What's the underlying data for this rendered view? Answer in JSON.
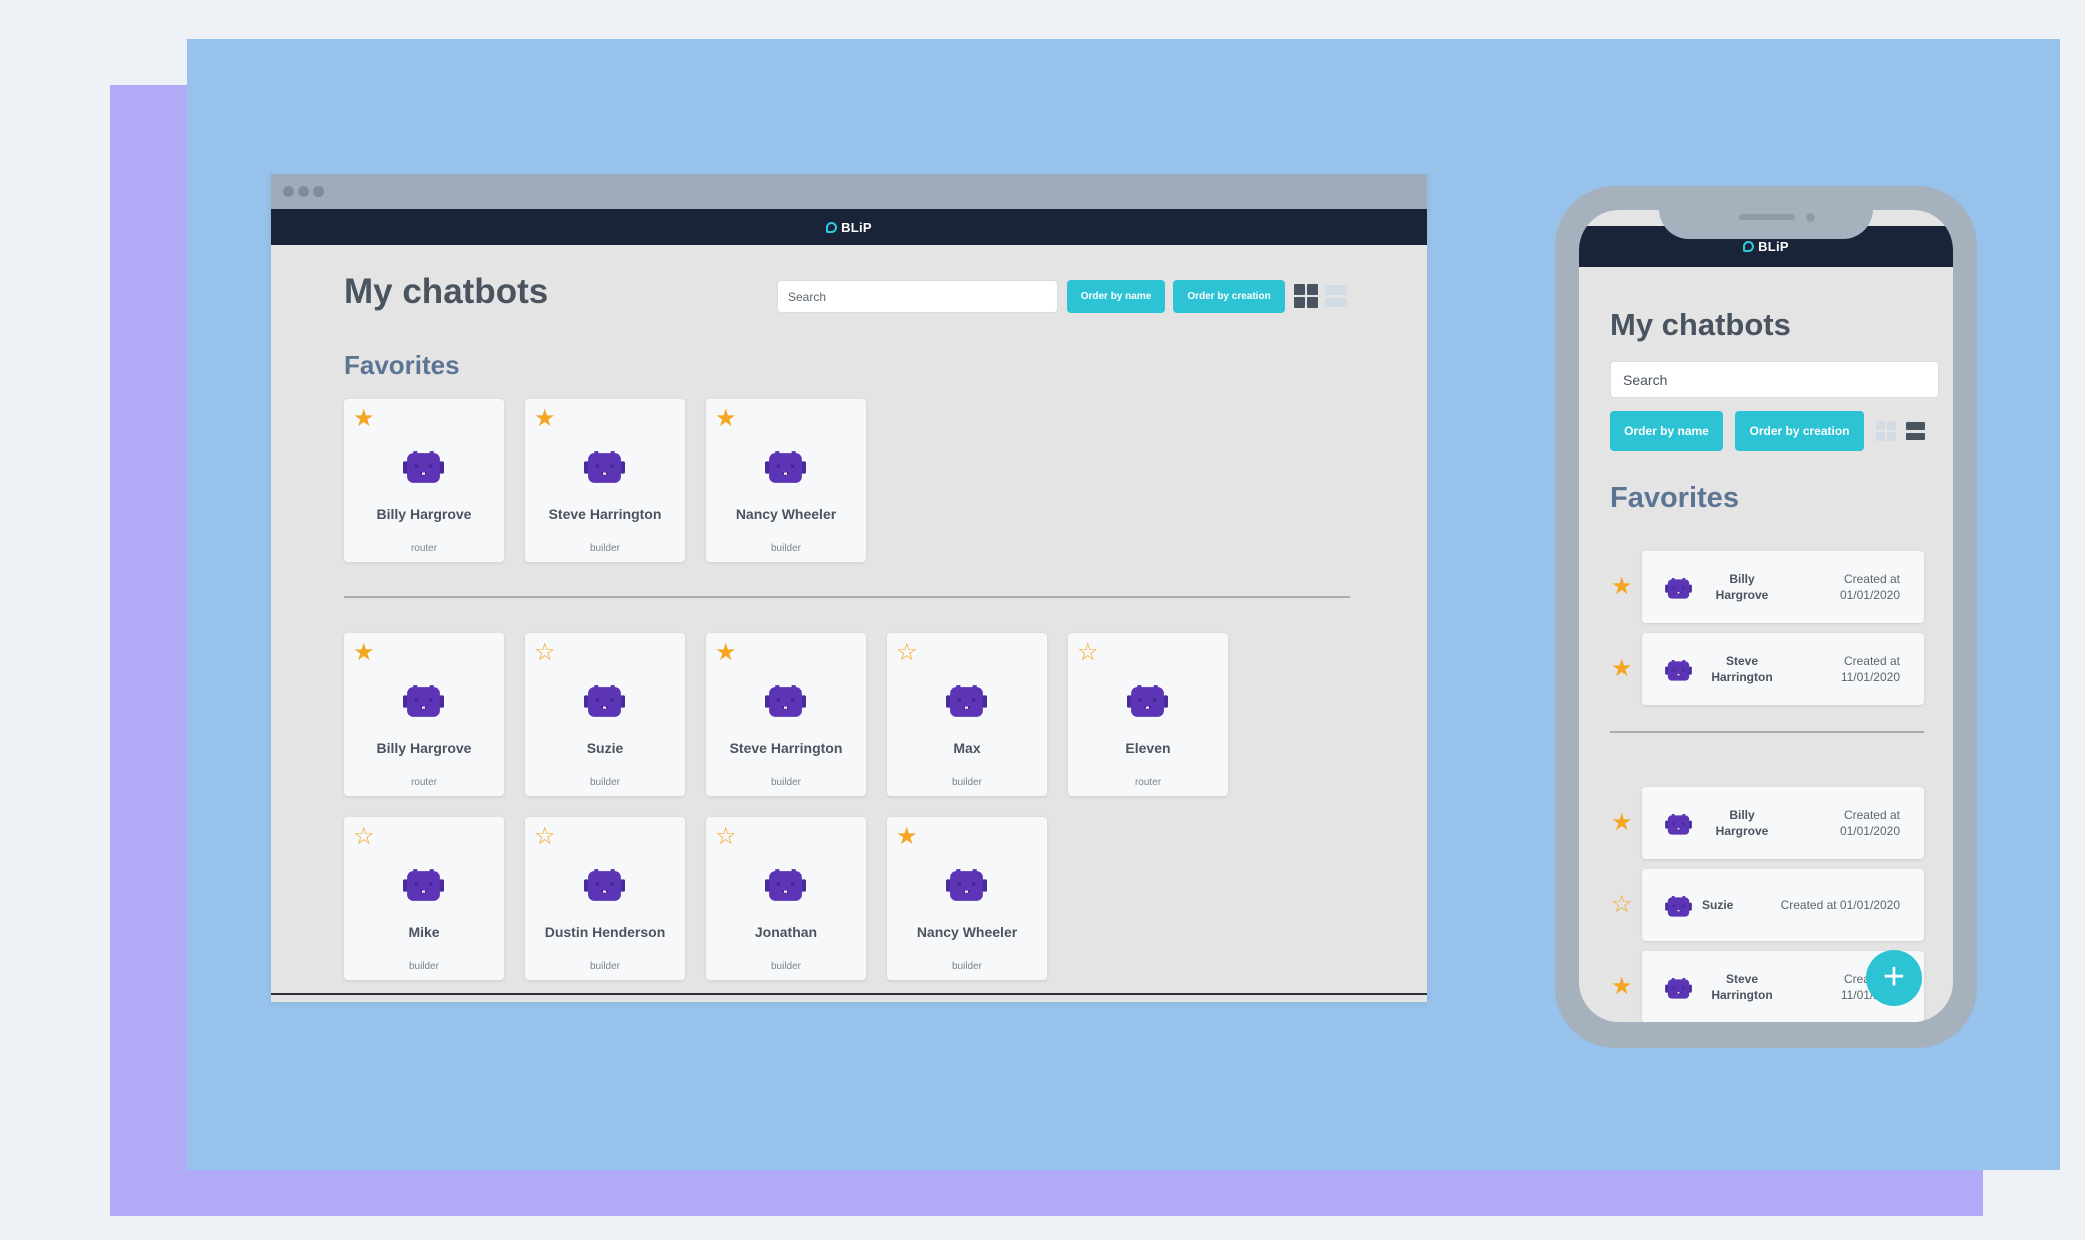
{
  "colors": {
    "accent": "#2cc3d5",
    "star": "#f5a623",
    "bot": "#5b35b5",
    "navbar": "#1a2438"
  },
  "logo_text": "BLiP",
  "desktop": {
    "title": "My chatbots",
    "search_placeholder": "Search",
    "order_by_name": "Order by name",
    "order_by_creation": "Order by creation",
    "favorites_title": "Favorites",
    "favorites": [
      {
        "name": "Billy Hargrove",
        "role": "router",
        "favorite": true
      },
      {
        "name": "Steve Harrington",
        "role": "builder",
        "favorite": true
      },
      {
        "name": "Nancy Wheeler",
        "role": "builder",
        "favorite": true
      }
    ],
    "bots": [
      {
        "name": "Billy Hargrove",
        "role": "router",
        "favorite": true
      },
      {
        "name": "Suzie",
        "role": "builder",
        "favorite": false
      },
      {
        "name": "Steve Harrington",
        "role": "builder",
        "favorite": true
      },
      {
        "name": "Max",
        "role": "builder",
        "favorite": false
      },
      {
        "name": "Eleven",
        "role": "router",
        "favorite": false
      },
      {
        "name": "Mike",
        "role": "builder",
        "favorite": false
      },
      {
        "name": "Dustin Henderson",
        "role": "builder",
        "favorite": false
      },
      {
        "name": "Jonathan",
        "role": "builder",
        "favorite": false
      },
      {
        "name": "Nancy Wheeler",
        "role": "builder",
        "favorite": true
      }
    ]
  },
  "mobile": {
    "title": "My chatbots",
    "search_placeholder": "Search",
    "order_by_name": "Order by name",
    "order_by_creation": "Order by creation",
    "favorites_title": "Favorites",
    "favorites": [
      {
        "name": "Billy Hargrove",
        "created": "Created at 01/01/2020",
        "favorite": true
      },
      {
        "name": "Steve Harrington",
        "created": "Created at 11/01/2020",
        "favorite": true
      }
    ],
    "bots": [
      {
        "name": "Billy Hargrove",
        "created": "Created at 01/01/2020",
        "favorite": true
      },
      {
        "name": "Suzie",
        "created": "Created at 01/01/2020",
        "favorite": false
      },
      {
        "name": "Steve Harrington",
        "created": "Created at 11/01/2020",
        "favorite": true
      }
    ],
    "fab_label": "+"
  }
}
